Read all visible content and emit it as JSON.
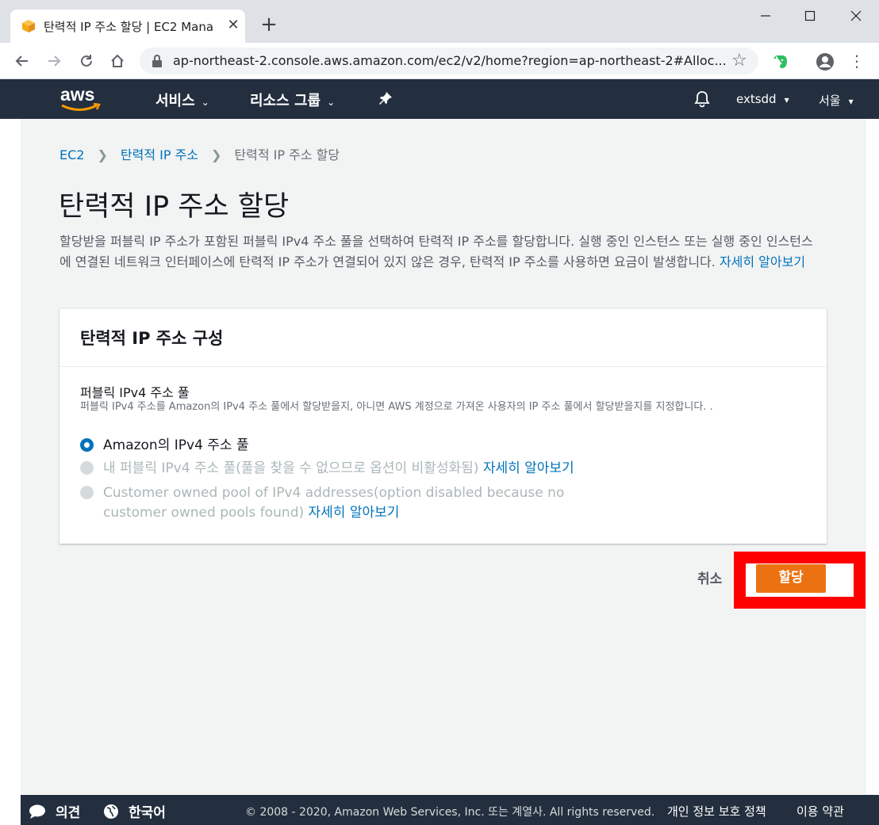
{
  "browser": {
    "tab_title": "탄력적 IP 주소 할당 | EC2 Mana",
    "tab_close": "✕",
    "new_tab": "+",
    "url": "ap-northeast-2.console.aws.amazon.com/ec2/v2/home?region=ap-northeast-2#Alloc...",
    "favicon_color": "#f7a81b"
  },
  "aws_nav": {
    "logo": "aws",
    "services": "서비스",
    "resource_groups": "리소스 그룹",
    "account": "extsdd",
    "region": "서울",
    "bg_color": "#232f3e"
  },
  "breadcrumb": {
    "items": [
      "EC2",
      "탄력적 IP 주소"
    ],
    "current": "탄력적 IP 주소 할당"
  },
  "page": {
    "title": "탄력적 IP 주소 할당",
    "description": "할당받을 퍼블릭 IP 주소가 포함된 퍼블릭 IPv4 주소 풀을 선택하여 탄력적 IP 주소를 할당합니다. 실행 중인 인스턴스 또는 실행 중인 인스턴스에 연결된 네트워크 인터페이스에 탄력적 IP 주소가 연결되어 있지 않은 경우, 탄력적 IP 주소를 사용하면 요금이 발생합니다.",
    "learn_more": "자세히 알아보기"
  },
  "panel": {
    "title": "탄력적 IP 주소 구성",
    "field_label": "퍼블릭 IPv4 주소 풀",
    "field_desc": "퍼블릭 IPv4 주소를 Amazon의 IPv4 주소 풀에서 할당받을지, 아니면 AWS 계정으로 가져온 사용자의 IP 주소 풀에서 할당받을지를 지정합니다. .",
    "options": [
      {
        "label": "Amazon의 IPv4 주소 풀",
        "selected": true,
        "disabled": false
      },
      {
        "label": "내 퍼블릭 IPv4 주소 풀(풀을 찾을 수 없으므로 옵션이 비활성화됨)",
        "link": "자세히 알아보기",
        "selected": false,
        "disabled": true
      },
      {
        "label": "Customer owned pool of IPv4 addresses(option disabled because no customer owned pools found)",
        "link": "자세히 알아보기",
        "selected": false,
        "disabled": true
      }
    ]
  },
  "actions": {
    "cancel": "취소",
    "allocate": "할당",
    "allocate_color": "#ec7211",
    "highlight_color": "#ff0000"
  },
  "footer": {
    "feedback": "의견",
    "language": "한국어",
    "copyright": "© 2008 - 2020, Amazon Web Services, Inc. 또는 계열사. All rights reserved.",
    "privacy": "개인 정보 보호 정책",
    "terms": "이용 약관"
  }
}
